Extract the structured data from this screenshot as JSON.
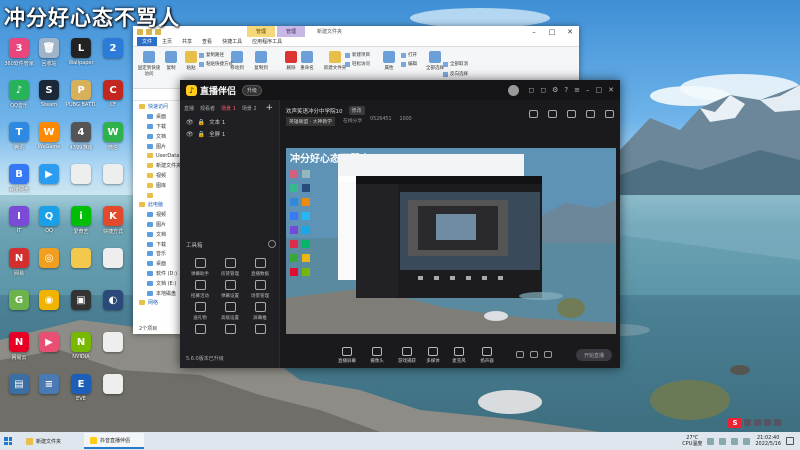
{
  "watermark": "冲分好心态不骂人",
  "desktop": {
    "icons": [
      {
        "label": "360软件管家",
        "color": "#e8467c",
        "glyph": "3"
      },
      {
        "label": "回收站",
        "color": "#9fb4c8",
        "glyph": "🗑"
      },
      {
        "label": "Wallpaper",
        "color": "#222222",
        "glyph": "L"
      },
      {
        "label": "",
        "color": "#2b7bd9",
        "glyph": "2"
      },
      {
        "label": "QQ音乐",
        "color": "#26b35a",
        "glyph": "♪"
      },
      {
        "label": "Steam",
        "color": "#1b2838",
        "glyph": "S"
      },
      {
        "label": "PUBG BATTLEGR",
        "color": "#d7b05a",
        "glyph": "P"
      },
      {
        "label": "CF",
        "color": "#c2281f",
        "glyph": "C"
      },
      {
        "label": "腾讯",
        "color": "#2e89e0",
        "glyph": "T"
      },
      {
        "label": "WeGame",
        "color": "#ff8a00",
        "glyph": "W"
      },
      {
        "label": "4399游戏",
        "color": "#555555",
        "glyph": "4"
      },
      {
        "label": "微信",
        "color": "#2fb24b",
        "glyph": "W"
      },
      {
        "label": "百度网盘",
        "color": "#3478f6",
        "glyph": "B"
      },
      {
        "label": "",
        "color": "#2c9cf0",
        "glyph": "▶"
      },
      {
        "label": "",
        "color": "#eeeeee",
        "glyph": ""
      },
      {
        "label": "",
        "color": "#eeeeee",
        "glyph": ""
      },
      {
        "label": "IT",
        "color": "#7b4bd8",
        "glyph": "I"
      },
      {
        "label": "QQ",
        "color": "#1aa0e8",
        "glyph": "Q"
      },
      {
        "label": "爱奇艺",
        "color": "#00be06",
        "glyph": "i"
      },
      {
        "label": "快捷方式",
        "color": "#e24a2b",
        "glyph": "K"
      },
      {
        "label": "网易",
        "color": "#d32f2f",
        "glyph": "N"
      },
      {
        "label": "",
        "color": "#f19f1e",
        "glyph": "◎"
      },
      {
        "label": "",
        "color": "#f2c94c",
        "glyph": ""
      },
      {
        "label": "",
        "color": "#eeeeee",
        "glyph": ""
      },
      {
        "label": "",
        "color": "#6bb34a",
        "glyph": "G"
      },
      {
        "label": "",
        "color": "#f0b400",
        "glyph": "◉"
      },
      {
        "label": "",
        "color": "#333333",
        "glyph": "▣"
      },
      {
        "label": "",
        "color": "#2b4a79",
        "glyph": "◐"
      },
      {
        "label": "网易云",
        "color": "#e60026",
        "glyph": "N"
      },
      {
        "label": "",
        "color": "#e94f72",
        "glyph": "▶"
      },
      {
        "label": "NVIDIA",
        "color": "#76b900",
        "glyph": "N"
      },
      {
        "label": "",
        "color": "#eeeeee",
        "glyph": ""
      },
      {
        "label": "",
        "color": "#3a6ea5",
        "glyph": "▤"
      },
      {
        "label": "",
        "color": "#4a7ab5",
        "glyph": "≡"
      },
      {
        "label": "EVE",
        "color": "#1d5fb8",
        "glyph": "E"
      },
      {
        "label": "",
        "color": "#eeeeee",
        "glyph": ""
      }
    ]
  },
  "explorer": {
    "ctx_tab_1": "管理",
    "ctx_tab_2": "管理",
    "title": "新建文件夹",
    "tabs": [
      "文件",
      "主页",
      "共享",
      "查看",
      "快捷工具",
      "应用程序工具"
    ],
    "ribbon": {
      "buttons": [
        "固定到快速访问",
        "复制",
        "粘贴",
        "移动到",
        "复制到",
        "删除",
        "重命名",
        "新建文件夹",
        "属性",
        "全部选择"
      ],
      "small": [
        "复制路径",
        "粘贴快捷方式",
        "新建项目",
        "轻松访问",
        "打开",
        "编辑",
        "全部取消",
        "反向选择"
      ]
    },
    "nav": [
      {
        "label": "快速访问",
        "kind": "group"
      },
      {
        "label": "桌面",
        "kind": "blue"
      },
      {
        "label": "下载",
        "kind": "blue"
      },
      {
        "label": "文档",
        "kind": "blue"
      },
      {
        "label": "图片",
        "kind": "blue"
      },
      {
        "label": "UserData",
        "kind": "folder"
      },
      {
        "label": "新建文件夹",
        "kind": "folder"
      },
      {
        "label": "视频",
        "kind": "folder"
      },
      {
        "label": "图库",
        "kind": "folder"
      },
      {
        "label": "",
        "kind": "folder"
      },
      {
        "label": "此电脑",
        "kind": "group"
      },
      {
        "label": "视频",
        "kind": "blue"
      },
      {
        "label": "图片",
        "kind": "blue"
      },
      {
        "label": "文档",
        "kind": "blue"
      },
      {
        "label": "下载",
        "kind": "blue"
      },
      {
        "label": "音乐",
        "kind": "blue"
      },
      {
        "label": "桌面",
        "kind": "blue"
      },
      {
        "label": "软件 (D:)",
        "kind": "blue"
      },
      {
        "label": "文档 (E:)",
        "kind": "blue"
      },
      {
        "label": "本地磁盘",
        "kind": "blue"
      },
      {
        "label": "网络",
        "kind": "group"
      }
    ],
    "status": "2个项目"
  },
  "stream": {
    "app_name": "直播伴侣",
    "version": "升级",
    "room_title": "欢声笑语冲分中学院10",
    "edit_tag": "修改",
    "category": "英雄联盟 · 大神教学",
    "meta_1": "在线分享",
    "meta_2": "0526451",
    "meta_3": "1000",
    "sidebar_tabs": [
      "直播",
      "观看者",
      "场景 1",
      "场景 2"
    ],
    "active_tab_index": 2,
    "layers": [
      "文本 1",
      "全屏 1"
    ],
    "tools_title": "工具箱",
    "tools": [
      "弹幕助手",
      "房管管理",
      "直播数据",
      "招募活动",
      "弹幕设置",
      "场景管理",
      "送礼物",
      "高级设置",
      "屏幕推",
      "",
      "",
      ""
    ],
    "footer": "5.6.0版本已升级",
    "controls": [
      "直播屏幕",
      "摄像头",
      "游戏捕获",
      "多媒体",
      "麦克风",
      "扬声器"
    ],
    "start_button": "开始直播"
  },
  "taskbar": {
    "tasks": [
      {
        "label": "新建文件夹",
        "color": "#e8bf49",
        "active": false
      },
      {
        "label": "抖音直播伴侣",
        "color": "#ffcc1a",
        "active": true
      }
    ],
    "weather_temp": "27℃",
    "weather_desc": "CPU温度",
    "time": "21:02:40",
    "date": "2022/5/16"
  },
  "colors": {
    "accent_red": "#ff5a5f",
    "stream_bg": "#1a1a1d",
    "taskbar_bg": "#dfe6ee"
  }
}
